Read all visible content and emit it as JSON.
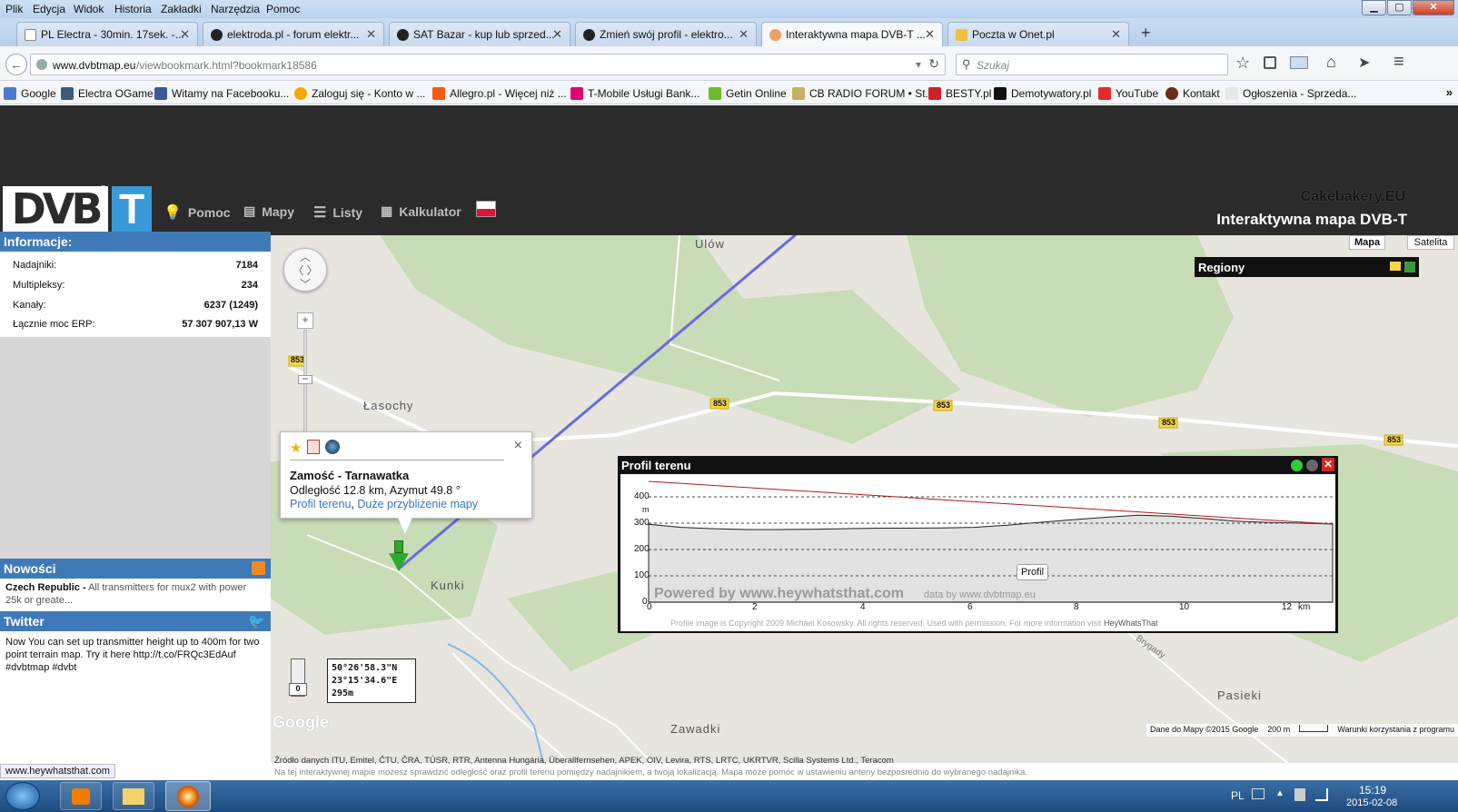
{
  "menubar": {
    "items": [
      "Plik",
      "Edycja",
      "Widok",
      "Historia",
      "Zakładki",
      "Narzędzia",
      "Pomoc"
    ]
  },
  "window_controls": {
    "minimize": "▁",
    "maximize": "▢",
    "close": "✕"
  },
  "tabs": [
    {
      "label": "PL Electra - 30min. 17sek. -...",
      "active": false
    },
    {
      "label": "elektroda.pl - forum elektr...",
      "active": false
    },
    {
      "label": "SAT Bazar - kup lub sprzed...",
      "active": false
    },
    {
      "label": "Zmień swój profil - elektro...",
      "active": false
    },
    {
      "label": "Interaktywna mapa DVB-T ...",
      "active": true
    },
    {
      "label": "Poczta w Onet.pl",
      "active": false
    }
  ],
  "newtab": "+",
  "navbar": {
    "url_host": "www.dvbtmap.eu",
    "url_path": "/viewbookmark.html?bookmark18586",
    "search_placeholder": "Szukaj"
  },
  "bookmarks": [
    "Google",
    "Electra OGame",
    "Witamy na Facebooku...",
    "Zaloguj się - Konto w ...",
    "Allegro.pl - Więcej niż ...",
    "T-Mobile Usługi Bank...",
    "Getin Online",
    "CB RADIO FORUM • St...",
    "BESTY.pl",
    "Demotywatory.pl",
    "YouTube",
    "Kontakt",
    "Ogłoszenia - Sprzeda..."
  ],
  "site": {
    "logo_text": "DVB",
    "logo_t": "T",
    "logo_reg": "®",
    "nav": [
      "Pomoc",
      "Mapy",
      "Listy",
      "Kalkulator"
    ],
    "brand": "Cakebakery.EU",
    "subtitle": "Interaktywna mapa DVB-T"
  },
  "info": {
    "title": "Informacje:",
    "rows": [
      {
        "label": "Nadajniki:",
        "value": "7184"
      },
      {
        "label": "Multipleksy:",
        "value": "234"
      },
      {
        "label": "Kanały:",
        "value": "6237 (1249)"
      },
      {
        "label": "Łącznie moc ERP:",
        "value": "57 307 907,13 W"
      }
    ]
  },
  "news": {
    "title": "Nowości",
    "item_country": "Czech Republic -",
    "item_text": "All transmitters for mux2 with power 25k or greate..."
  },
  "twitter": {
    "title": "Twitter",
    "text": "Now You can set up transmitter height up to 400m for two point terrain map. Try it here http://t.co/FRQc3EdAuf #dvbtmap #dvbt"
  },
  "map": {
    "type_buttons": [
      "Mapa",
      "Satelita"
    ],
    "regions_title": "Regiony",
    "places": [
      "Ulów",
      "Łasochy",
      "Kunki",
      "Zawadki",
      "Pasieki",
      "Brygady"
    ],
    "road_labels": [
      "853",
      "853",
      "853",
      "853",
      "853"
    ],
    "zoom_plus": "+",
    "zoom_minus": "−",
    "coords": [
      "50°26'58.3\"N",
      "23°15'34.6\"E",
      "295m"
    ],
    "pegman_value": "0",
    "google": "Google",
    "data_attribution": "Dane do Mapy ©2015 Google",
    "scale": "200 m",
    "terms": "Warunki korzystania z programu"
  },
  "popup": {
    "close": "×",
    "title": "Zamość - Tarnawatka",
    "distance": "Odległość 12.8 km, Azymut 49.8 °",
    "link_profile": "Profil terenu",
    "link_zoom": "Duże przybliżenie mapy"
  },
  "profile": {
    "title": "Profil terenu",
    "button": "Profil",
    "powered": "Powered by www.heywhatsthat.com",
    "data_by": "data by www.dvbtmap.eu",
    "unit": "m",
    "copyright": "Profile image is Copyright 2009 Michael Kosowsky. All rights reserved. Used with permission. For more information visit",
    "copyright_link": "HeyWhatsThat",
    "km_label": "km",
    "y_ticks": [
      "400",
      "300",
      "200",
      "100",
      "0"
    ],
    "x_ticks": [
      "0",
      "2",
      "4",
      "6",
      "8",
      "10",
      "12"
    ]
  },
  "footer": {
    "source": "Źródło danych ITU, Emitel, ČTU, ČRA, TÚSR, RTR, Antenna Hungária, Überallfernsehen, APEK, OIV, Levira, RTS, LRTC, UKRTVR, Scilla Systems Ltd., Teracom",
    "note": "Na tej interaktywnej mapie możesz sprawdzić odległość oraz profil terenu pomiędzy nadajnikiem, a twoją lokalizacją. Mapa może pomóc w ustawieniu anteny bezpośrednio do wybranego nadajnika.",
    "status_url": "www.heywhatsthat.com"
  },
  "taskbar": {
    "lang": "PL",
    "time": "15:19",
    "date": "2015-02-08"
  }
}
